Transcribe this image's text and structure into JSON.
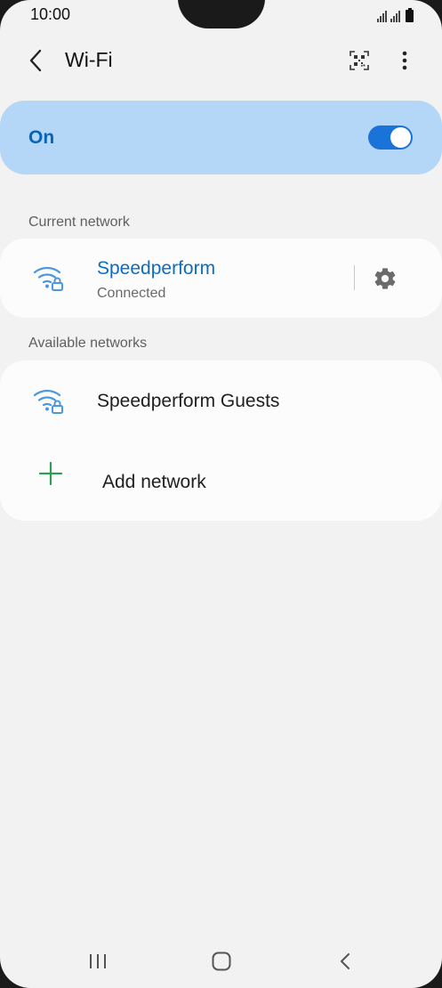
{
  "status_bar": {
    "time": "10:00"
  },
  "header": {
    "title": "Wi-Fi",
    "icons": {
      "back": "chevron-left-icon",
      "qr": "qr-code-icon",
      "more": "more-vert-icon"
    }
  },
  "master_switch": {
    "label": "On",
    "checked": true
  },
  "current_network": {
    "section_label": "Current network",
    "name": "Speedperform",
    "status": "Connected",
    "icon": "wifi-lock-icon",
    "settings_icon": "gear-icon"
  },
  "available_networks": {
    "section_label": "Available networks",
    "items": [
      {
        "name": "Speedperform Guests",
        "icon": "wifi-lock-icon"
      }
    ],
    "add_label": "Add network",
    "add_icon": "plus-icon"
  },
  "nav_bar": {
    "icons": [
      "recent-apps-icon",
      "home-icon",
      "back-icon"
    ]
  },
  "colors": {
    "accent": "#1a73d9",
    "accent_text": "#0a64b5",
    "switch_card": "#b4d7f8",
    "wifi_icon": "#4a98e0",
    "add_icon": "#2e9e55",
    "background": "#f2f2f2",
    "card": "#fcfcfc"
  }
}
